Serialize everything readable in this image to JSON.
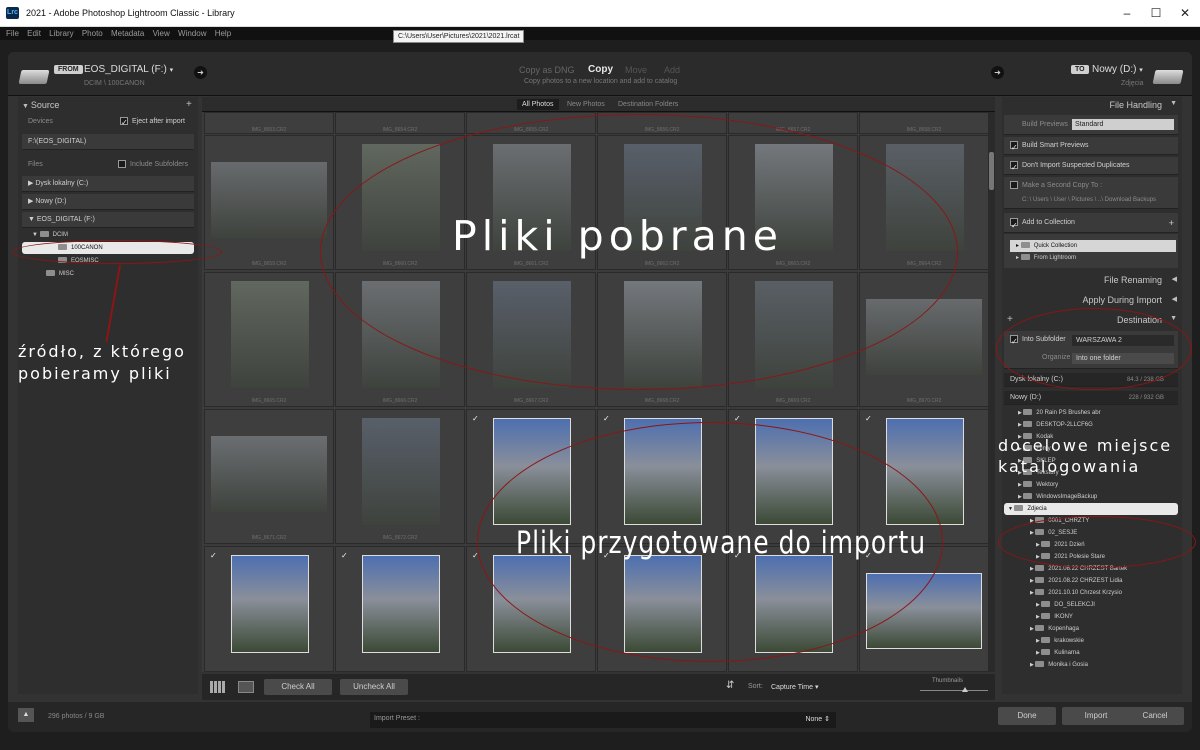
{
  "window": {
    "title": "2021 - Adobe Photoshop Lightroom Classic - Library",
    "app_icon_label": "Lrc"
  },
  "menu": [
    "File",
    "Edit",
    "Library",
    "Photo",
    "Metadata",
    "View",
    "Window",
    "Help"
  ],
  "tooltip": "C:\\Users\\User\\Pictures\\2021\\2021.lrcat",
  "header": {
    "from_tag": "FROM",
    "source_name": "EOS_DIGITAL (F:)",
    "source_sub": "DCIM \\ 100CANON",
    "modes": [
      "Copy as DNG",
      "Copy",
      "Move",
      "Add"
    ],
    "active_mode": "Copy",
    "mode_desc": "Copy photos to a new location and add to catalog",
    "to_tag": "TO",
    "dest_name": "Nowy (D:)",
    "dest_sub": "Zdjęcia"
  },
  "source": {
    "title": "Source",
    "devices_label": "Devices",
    "eject_label": "Eject after import",
    "device": "F:\\(EOS_DIGITAL)",
    "files_label": "Files",
    "include_sub": "Include Subfolders",
    "drives": [
      "Dysk lokalny (C:)",
      "Nowy (D:)",
      "EOS_DIGITAL (F:)"
    ],
    "folders": [
      "DCIM",
      "100CANON",
      "EOSMISC",
      "MISC"
    ]
  },
  "tabs": [
    "All Photos",
    "New Photos",
    "Destination Folders"
  ],
  "grid": {
    "row_top_names": [
      "IMG_8653.CR2",
      "IMG_8654.CR2",
      "IMG_8655.CR2",
      "IMG_8656.CR2",
      "IMG_8657.CR2",
      "IMG_8658.CR2"
    ],
    "row1_names": [
      "IMG_8659.CR2",
      "IMG_8660.CR2",
      "IMG_8661.CR2",
      "IMG_8662.CR2",
      "IMG_8663.CR2",
      "IMG_8664.CR2"
    ],
    "row2_names": [
      "IMG_8665.CR2",
      "IMG_8666.CR2",
      "IMG_8667.CR2",
      "IMG_8668.CR2",
      "IMG_8669.CR2",
      "IMG_8670.CR2"
    ],
    "row3_names": [
      "IMG_8671.CR2",
      "IMG_8672.CR2",
      "",
      "",
      "",
      ""
    ]
  },
  "gridbar": {
    "check_all": "Check All",
    "uncheck_all": "Uncheck All",
    "sort_label": "Sort:",
    "sort_value": "Capture Time",
    "thumbnails": "Thumbnails"
  },
  "right": {
    "file_handling": "File Handling",
    "build_previews_label": "Build Previews",
    "build_previews_value": "Standard",
    "smart_previews": "Build Smart Previews",
    "no_duplicates": "Don't Import Suspected Duplicates",
    "second_copy": "Make a Second Copy To :",
    "second_copy_path": "C: \\ Users \\ User \\ Pictures \\ ..\\ Download Backups",
    "add_collection": "Add to Collection",
    "quick_collection": "Quick Collection",
    "from_lightroom": "From Lightroom",
    "file_renaming": "File Renaming",
    "apply_during": "Apply During Import",
    "destination": "Destination",
    "into_subfolder": "Into Subfolder",
    "subfolder_name": "WARSZAWA 2",
    "organize_label": "Organize",
    "organize_value": "Into one folder",
    "drive_c": "Dysk lokalny (C:)",
    "drive_c_space": "84.3 / 238 GB",
    "drive_d": "Nowy (D:)",
    "drive_d_space": "228 / 932 GB",
    "tree": [
      "20 Rain PS Brushes abr",
      "DESKTOP-2LLCF6G",
      "Kodak",
      "Filmy",
      "SKLEP",
      "Tekstury",
      "Wektory",
      "WindowsImageBackup",
      "Zdjecia",
      "0001_CHRZTY",
      "02_SESJE",
      "2021 Dzień",
      "2021 Polesie Stare",
      "2021.08.22 CHRZEST Bartek",
      "2021.08.22 CHRZEST Lidia",
      "2021.10.10 Chrzest Krzysio",
      "DO_SELEKCJI",
      "IKONY",
      "Kopenhaga",
      "krakowskie",
      "Kulinarna",
      "Monika i Gosia"
    ]
  },
  "footer": {
    "count": "296 photos / 9 GB",
    "preset_label": "Import Preset :",
    "preset_value": "None",
    "done": "Done",
    "import": "Import",
    "cancel": "Cancel"
  },
  "annotations": {
    "pobrane": "Pliki pobrane",
    "przygotowane": "Pliki przygotowane do importu",
    "zrodlo_1": "źródło, z którego",
    "zrodlo_2": "pobieramy pliki",
    "docelowe_1": "docelowe miejsce",
    "docelowe_2": "katalogowania",
    "accent_color": "#8c1515"
  }
}
